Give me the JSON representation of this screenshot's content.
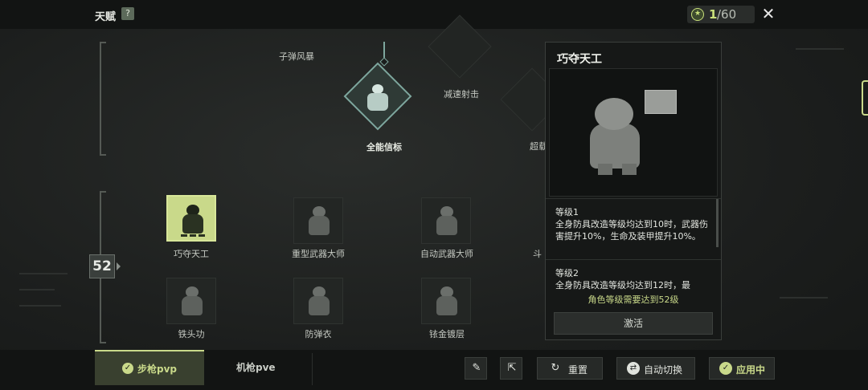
{
  "header": {
    "title": "天赋",
    "help_label": "?",
    "points_current": "1",
    "points_total": "/60",
    "close_label": "✕"
  },
  "tree": {
    "level_marker": "52",
    "top_nodes": {
      "bullet_storm": "子弹风暴",
      "slow_shot": "减速射击",
      "all_round_beacon": "全能信标",
      "partial_right": "超载"
    },
    "row1": [
      "巧夺天工",
      "重型武器大师",
      "自动武器大师"
    ],
    "row1_partial": "斗",
    "row2": [
      "铁头功",
      "防弹衣",
      "铱金镀层"
    ]
  },
  "panel": {
    "title": "巧夺天工",
    "levels": [
      {
        "name": "等级1",
        "desc": "全身防具改造等级均达到10时，武器伤害提升10%，生命及装甲提升10%。"
      },
      {
        "name": "等级2",
        "desc": "全身防具改造等级均达到12时，最"
      }
    ],
    "requirement": "角色等级需要达到52级",
    "activate_label": "激活"
  },
  "bottom": {
    "tab_active_label": "步枪pvp",
    "tab_inactive_label": "机枪pve",
    "reset_label": "重置",
    "auto_switch_label": "自动切换",
    "apply_label": "应用中"
  },
  "colors": {
    "accent": "#c9d98a",
    "teal": "#7ea79e",
    "background": "#1b1d1c"
  }
}
